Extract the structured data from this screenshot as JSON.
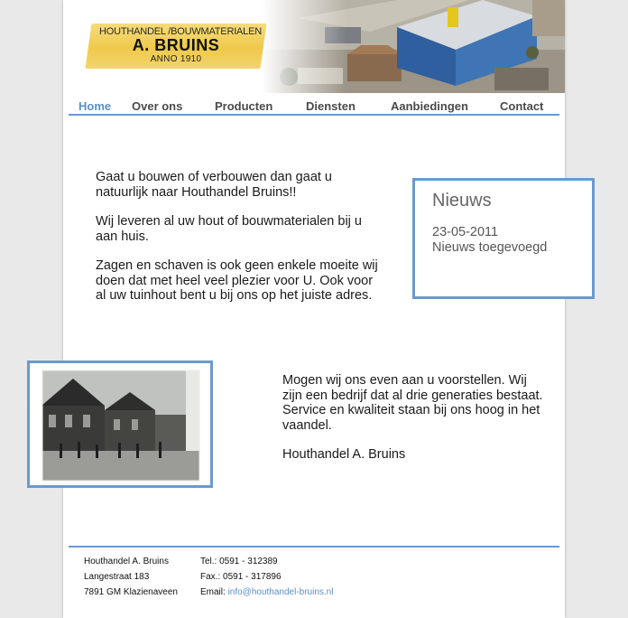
{
  "logo": {
    "line1": "HOUTHANDEL /BOUWMATERIALEN",
    "line2": "A. BRUINS",
    "line3": "ANNO 1910"
  },
  "nav": {
    "items": [
      "Home",
      "Over ons",
      "Producten",
      "Diensten",
      "Aanbiedingen",
      "Contact"
    ],
    "active": "Home"
  },
  "intro": {
    "paragraphs": [
      "Gaat u bouwen of verbouwen dan gaat u natuurlijk naar Houthandel Bruins!!",
      "Wij leveren al uw hout of bouwmaterialen bij u aan huis.",
      "Zagen en schaven is ook geen enkele moeite wij doen dat met heel veel plezier voor U. Ook voor al uw tuinhout bent u bij ons op het juiste adres."
    ]
  },
  "news": {
    "title": "Nieuws",
    "date": "23-05-2011",
    "text": "Nieuws toegevoegd"
  },
  "about": {
    "paragraphs": [
      "Mogen wij ons even aan u voorstellen. Wij zijn een bedrijf dat al drie generaties bestaat. Service en kwaliteit staan bij ons hoog in het vaandel.",
      "Houthandel A. Bruins"
    ]
  },
  "footer": {
    "company": "Houthandel A. Bruins",
    "street": "Langestraat 183",
    "city": "7891 GM Klazienaveen",
    "tel": "Tel.: 0591 - 312389",
    "fax": "Fax.: 0591 - 317896",
    "email_label": "Email: ",
    "email": "info@houthandel-bruins.nl"
  },
  "colors": {
    "accent": "#6b99cf",
    "active_nav": "#5b8fc8",
    "logo_yellow": "#efc94c"
  }
}
